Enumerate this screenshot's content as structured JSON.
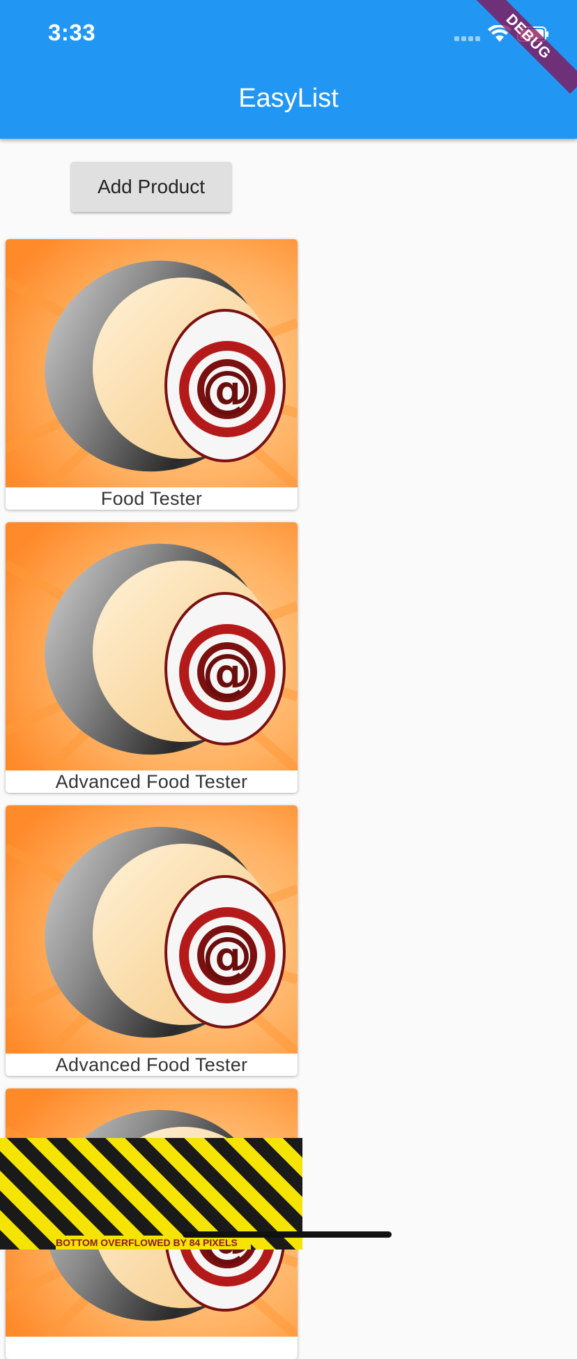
{
  "status_bar": {
    "time": "3:33",
    "icons": [
      "signal-icon",
      "wifi-icon",
      "battery-icon"
    ]
  },
  "app_bar": {
    "title": "EasyList",
    "color": "#2196f3"
  },
  "debug_banner": "DEBUG",
  "actions": {
    "add_product_label": "Add Product"
  },
  "products": [
    {
      "title": "Food Tester",
      "image": "product-image"
    },
    {
      "title": "Advanced Food Tester",
      "image": "product-image"
    },
    {
      "title": "Advanced Food Tester",
      "image": "product-image"
    },
    {
      "title": "",
      "image": "product-image"
    }
  ],
  "overflow_warning": "BOTTOM OVERFLOWED BY 84 PIXELS"
}
